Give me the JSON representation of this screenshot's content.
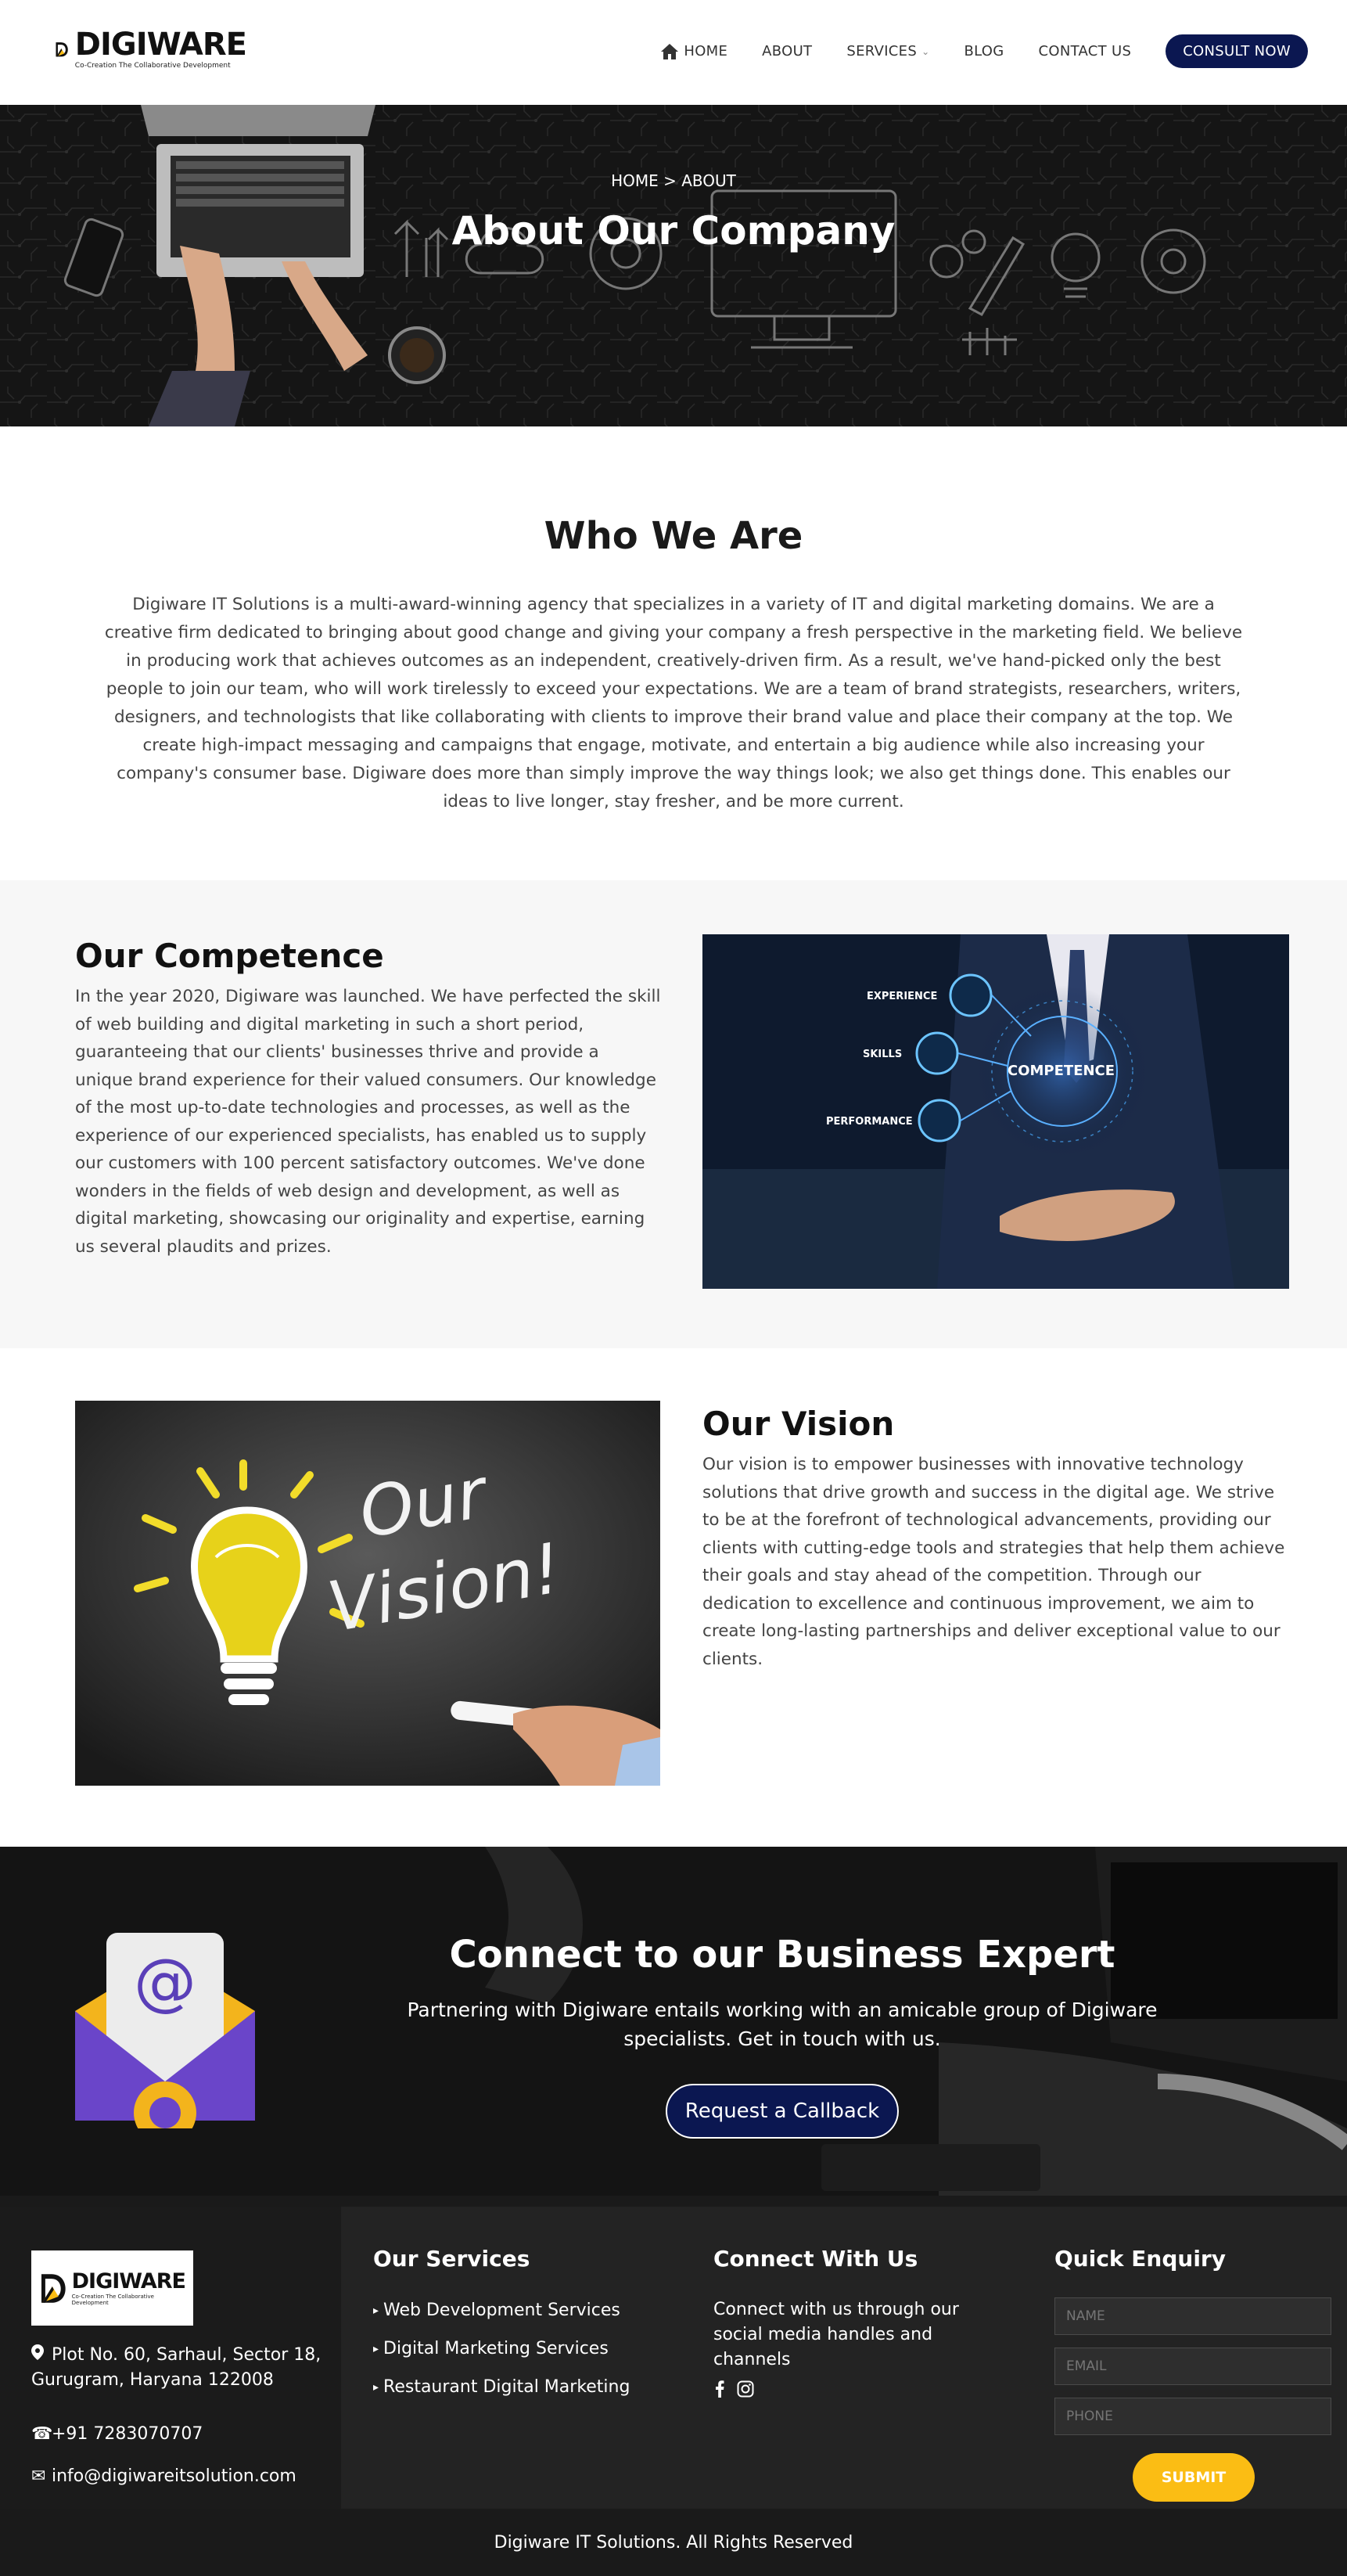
{
  "header": {
    "brand": "DIGIWARE",
    "tagline": "Co-Creation The Collaborative Development",
    "nav": [
      {
        "label": "HOME",
        "icon": "home-icon"
      },
      {
        "label": "ABOUT"
      },
      {
        "label": "SERVICES",
        "icon": "chevron-down-icon"
      },
      {
        "label": "BLOG"
      },
      {
        "label": "CONTACT US"
      }
    ],
    "cta": "CONSULT NOW",
    "cta_color": "#0b1751"
  },
  "hero": {
    "title": "About Our Company",
    "breadcrumb_home": "HOME",
    "breadcrumb_sep": ">",
    "breadcrumb_current": "ABOUT"
  },
  "who": {
    "title": "Who We Are",
    "body": "Digiware IT Solutions is a multi-award-winning agency that specializes in a variety of IT and digital marketing domains. We are a creative firm dedicated to bringing about good change and giving your company a fresh perspective in the marketing field. We believe in producing work that achieves outcomes as an independent, creatively-driven firm. As a result, we've hand-picked only the best people to join our team, who will work tirelessly to exceed your expectations. We are a team of brand strategists, researchers, writers, designers, and technologists that like collaborating with clients to improve their brand value and place their company at the top. We create high-impact messaging and campaigns that engage, motivate, and entertain a big audience while also increasing your company's consumer base. Digiware does more than simply improve the way things look; we also get things done. This enables our ideas to live longer, stay fresher, and be more current."
  },
  "competence": {
    "title": "Our Competence",
    "body": "In the year 2020, Digiware was launched. We have perfected the skill of web building and digital marketing in such a short period, guaranteeing that our clients' businesses thrive and provide a unique brand experience for their valued consumers. Our knowledge of the most up-to-date technologies and processes, as well as the experience of our experienced specialists, has enabled us to supply our customers with 100 percent satisfactory outcomes. We've done wonders in the fields of web design and development, as well as digital marketing, showcasing our originality and expertise, earning us several plaudits and prizes.",
    "image_labels": {
      "experience": "EXPERIENCE",
      "skills": "SKILLS",
      "performance": "PERFORMANCE",
      "center": "COMPETENCE"
    }
  },
  "vision": {
    "title": "Our Vision",
    "body": "Our vision is to empower businesses with innovative technology solutions that drive growth and success in the digital age. We strive to be at the forefront of technological advancements, providing our clients with cutting-edge tools and strategies that help them achieve their goals and stay ahead of the competition. Through our dedication to excellence and continuous improvement, we aim to create long-lasting partnerships and deliver exceptional value to our clients.",
    "image_text_line1": "Our",
    "image_text_line2": "Vision!"
  },
  "connect": {
    "title": "Connect to our Business Expert",
    "description": "Partnering with Digiware entails working with an amicable group of Digiware specialists. Get in touch with us.",
    "button": "Request a Callback"
  },
  "footer": {
    "address": "Plot No. 60, Sarhaul, Sector 18, Gurugram, Haryana 122008",
    "phone": "+91 7283070707",
    "email": "info@digiwareitsolution.com",
    "services_title": "Our Services",
    "services": [
      "Web Development Services",
      "Digital Marketing Services",
      "Restaurant Digital Marketing"
    ],
    "connect_title": "Connect With Us",
    "connect_text": "Connect with us through our social media handles and channels",
    "socials": [
      "facebook-icon",
      "instagram-icon"
    ],
    "enquiry_title": "Quick Enquiry",
    "enquiry_fields": [
      {
        "placeholder": "NAME"
      },
      {
        "placeholder": "EMAIL"
      },
      {
        "placeholder": "PHONE"
      }
    ],
    "submit": "SUBMIT",
    "submit_color": "#fbbd14",
    "copyright": "Digiware IT Solutions. All Rights Reserved"
  }
}
